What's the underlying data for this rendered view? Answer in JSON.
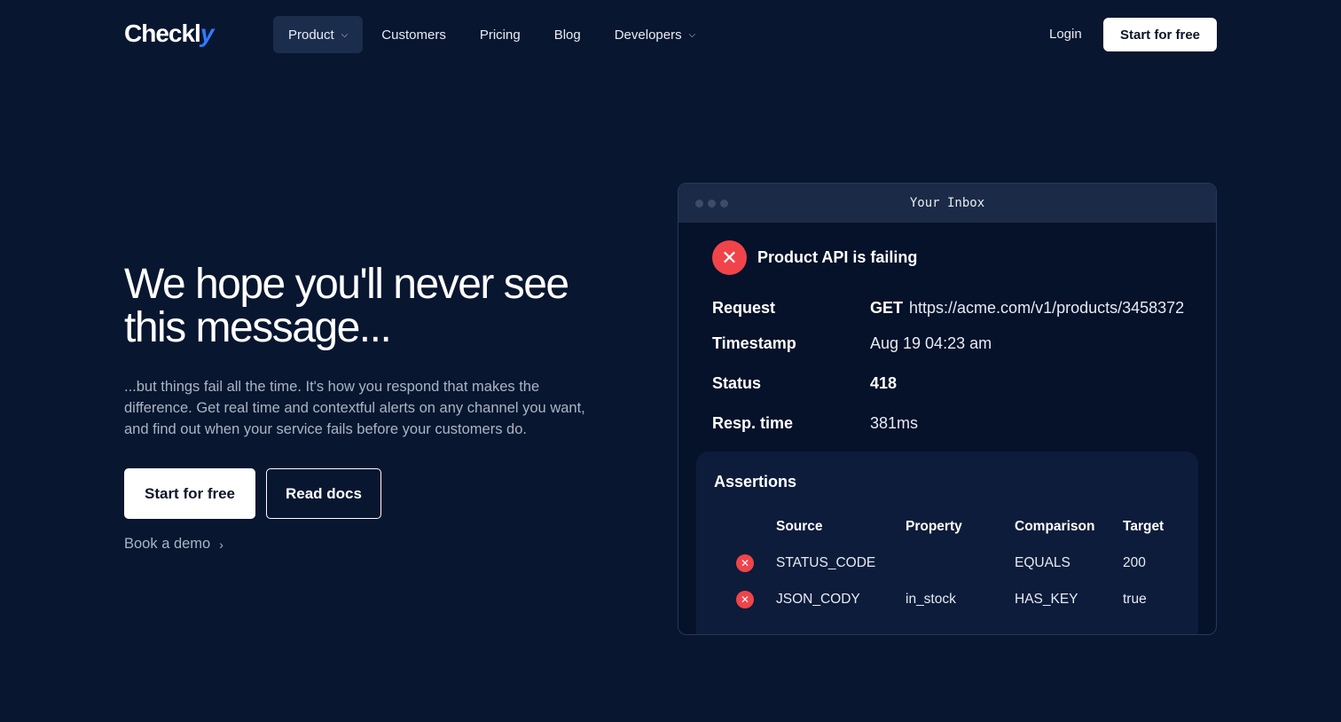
{
  "brand": {
    "logo_main": "Checkl",
    "logo_accent": "y"
  },
  "nav": {
    "items": [
      {
        "label": "Product",
        "dropdown": true,
        "active": true
      },
      {
        "label": "Customers"
      },
      {
        "label": "Pricing"
      },
      {
        "label": "Blog"
      },
      {
        "label": "Developers",
        "dropdown": true
      }
    ],
    "login": "Login",
    "cta": "Start for free"
  },
  "hero": {
    "title": "We hope you'll never see this message...",
    "description": "...but things fail all the time. It's how you respond that makes the difference. Get real time and contextful alerts on any channel you want, and find out when your service fails before your customers do.",
    "primary_cta": "Start for free",
    "secondary_cta": "Read docs",
    "demo_link": "Book a demo"
  },
  "inbox": {
    "window_title": "Your Inbox",
    "alert_title": "Product API is failing",
    "request_label": "Request",
    "request_method": "GET",
    "request_url": "https://acme.com/v1/products/3458372",
    "timestamp_label": "Timestamp",
    "timestamp_value": "Aug 19 04:23 am",
    "status_label": "Status",
    "status_value": "418",
    "resp_label": "Resp. time",
    "resp_value": "381ms",
    "assertions": {
      "title": "Assertions",
      "headers": {
        "source": "Source",
        "property": "Property",
        "comparison": "Comparison",
        "target": "Target"
      },
      "rows": [
        {
          "source": "STATUS_CODE",
          "property": "",
          "comparison": "EQUALS",
          "target": "200"
        },
        {
          "source": "JSON_CODY",
          "property": "in_stock",
          "comparison": "HAS_KEY",
          "target": "true"
        }
      ]
    }
  },
  "colors": {
    "background": "#081630",
    "accent": "#2f7bff",
    "error": "#f0444a"
  }
}
